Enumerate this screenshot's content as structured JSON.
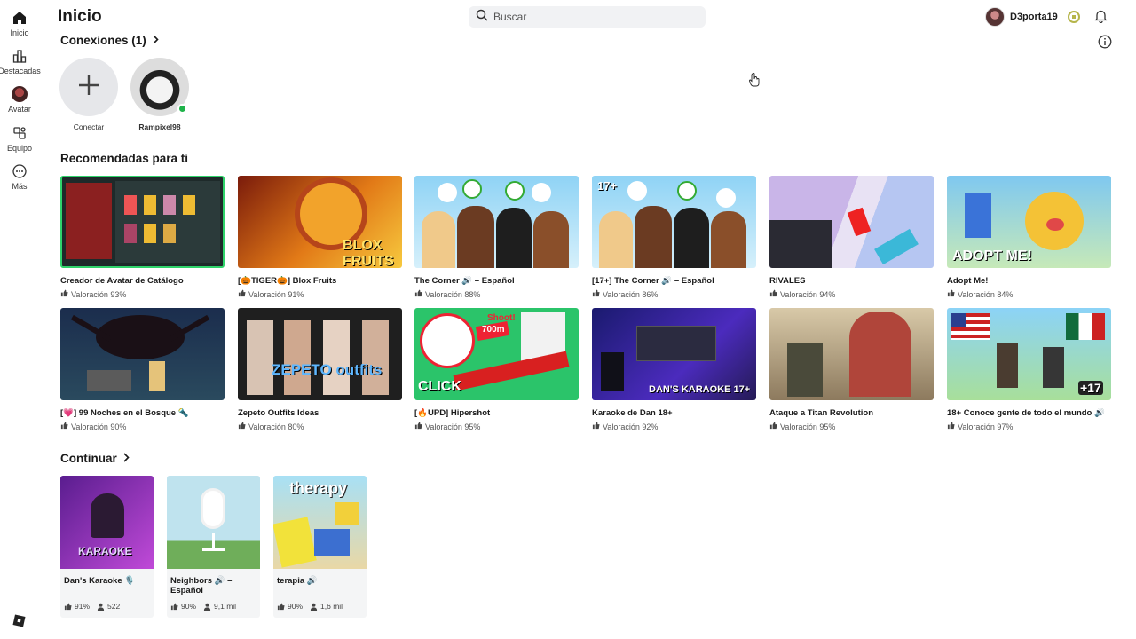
{
  "sidebar": {
    "items": [
      {
        "label": "Inicio",
        "icon": "home-icon"
      },
      {
        "label": "Destacadas",
        "icon": "chart-icon"
      },
      {
        "label": "Avatar",
        "icon": "avatar-icon"
      },
      {
        "label": "Equipo",
        "icon": "team-icon"
      },
      {
        "label": "Más",
        "icon": "more-icon"
      }
    ]
  },
  "header": {
    "title": "Inicio",
    "search_placeholder": "Buscar",
    "username": "D3porta19"
  },
  "connections": {
    "title": "Conexiones (1)",
    "items": [
      {
        "name": "Conectar"
      },
      {
        "name": "Rampixel98",
        "online": true
      }
    ]
  },
  "recommended": {
    "title": "Recomendadas para ti",
    "games": [
      {
        "title": "Creador de Avatar de Catálogo",
        "rating": "Valoración 93%"
      },
      {
        "title": "[🎃TIGER🎃] Blox Fruits",
        "rating": "Valoración 91%"
      },
      {
        "title": "The Corner 🔊 – Español",
        "rating": "Valoración 88%"
      },
      {
        "title": "[17+] The Corner 🔊 – Español",
        "rating": "Valoración 86%"
      },
      {
        "title": "RIVALES",
        "rating": "Valoración 94%"
      },
      {
        "title": "Adopt Me!",
        "rating": "Valoración 84%"
      },
      {
        "title": "[💗] 99 Noches en el Bosque 🔦",
        "rating": "Valoración 90%"
      },
      {
        "title": "Zepeto Outfits Ideas",
        "rating": "Valoración 80%"
      },
      {
        "title": "[🔥UPD] Hipershot",
        "rating": "Valoración 95%"
      },
      {
        "title": "Karaoke de Dan 18+",
        "rating": "Valoración 92%"
      },
      {
        "title": "Ataque a Titan Revolution",
        "rating": "Valoración 95%"
      },
      {
        "title": "18+ Conoce gente de todo el mundo 🔊",
        "rating": "Valoración 97%"
      }
    ],
    "thumb_texts": {
      "blox": "BLOX FRUITS",
      "adopt": "ADOPT ME!",
      "zepeto": "ZEPETO outfits",
      "click": "CLICK",
      "shoot": "Shoot!",
      "dist": "700m",
      "dan": "DAN'S KARAOKE 17+",
      "plus17": "+17",
      "tag17": "17+"
    }
  },
  "continue": {
    "title": "Continuar",
    "items": [
      {
        "title": "Dan's Karaoke 🎙️",
        "rating": "91%",
        "players": "522",
        "thumb_text": "KARAOKE"
      },
      {
        "title": "Neighbors 🔊 – Español",
        "rating": "90%",
        "players": "9,1 mil"
      },
      {
        "title": "terapia 🔊",
        "rating": "90%",
        "players": "1,6 mil",
        "thumb_text": "therapy"
      }
    ]
  }
}
